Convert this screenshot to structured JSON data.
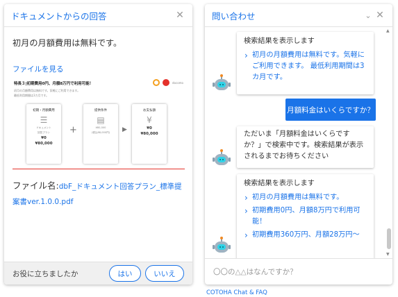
{
  "left_panel": {
    "title": "ドキュメントからの回答",
    "answer": "初月の月額費用は無料です。",
    "view_file_link": "ファイルを見る",
    "thumbnail": {
      "headline": "特長３|初期費用0円、月額8万円で利用可能！",
      "sub1": "初月の月額費用は無料です。気軽にご利用できます。",
      "sub2": "最低利用期間は3カ月です。",
      "logo_text": "docomo",
      "cards": [
        {
          "title": "初期・月額費用",
          "icon": "sliders-icon",
          "line1": "ドキュメント",
          "line2": "回答プラン",
          "value1": "¥0",
          "value2": "¥80,000"
        },
        {
          "title": "提供条件",
          "icon": "document-icon",
          "line1": "¥80,000",
          "line2": "(税込88,000円)",
          "value1": "",
          "value2": ""
        },
        {
          "title": "お支払額",
          "icon": "yen-icon",
          "line1": "",
          "line2": "",
          "value1": "¥0",
          "value2": "¥80,000"
        }
      ]
    },
    "file_label": "ファイル名:",
    "file_name": "dbF_ドキュメント回答プラン_標準提案書ver.1.0.0.pdf",
    "footer": {
      "question": "お役に立ちましたか",
      "yes_label": "はい",
      "no_label": "いいえ"
    }
  },
  "right_panel": {
    "title": "問い合わせ",
    "messages": [
      {
        "from": "bot",
        "header": "検索結果を表示します",
        "links": [
          "初月の月額費用は無料です。気軽にご利用できます。 最低利用期間は3カ月です。"
        ]
      },
      {
        "from": "user",
        "text": "月額料金はいくらですか？"
      },
      {
        "from": "bot",
        "text": "ただいま「月額料金はいくらですか？」で検索中です。検索結果が表示されるまでお待ちください"
      },
      {
        "from": "bot",
        "header": "検索結果を表示します",
        "links": [
          "初月の月額費用は無料です。",
          "初期費用0円、月額8万円で利用可能！",
          "初期費用360万円、月額28万円〜"
        ]
      }
    ],
    "input_placeholder": "〇〇の△△はなんですか？"
  },
  "caption": "COTOHA Chat & FAQ"
}
